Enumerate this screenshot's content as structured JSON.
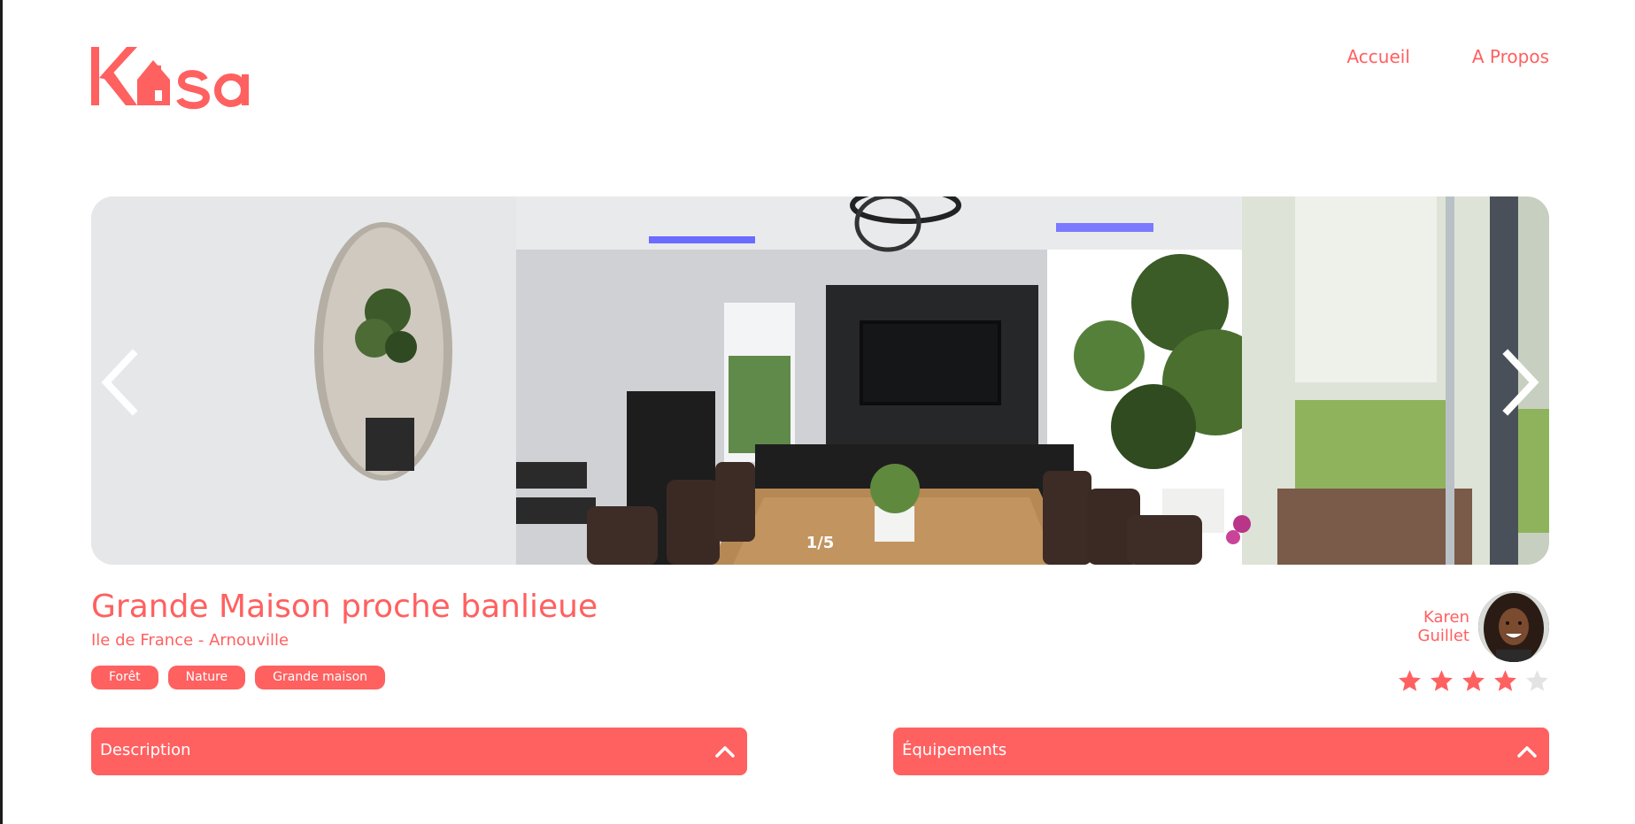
{
  "header": {
    "logo_text": "Kasa",
    "nav": [
      {
        "label": "Accueil"
      },
      {
        "label": "A Propos"
      }
    ]
  },
  "gallery": {
    "counter": "1/5",
    "prev_icon": "chevron-left-icon",
    "next_icon": "chevron-right-icon"
  },
  "listing": {
    "title": "Grande Maison proche banlieue",
    "location": "Ile de France - Arnouville",
    "tags": [
      "Forêt",
      "Nature",
      "Grande maison"
    ]
  },
  "host": {
    "first_name": "Karen",
    "last_name": "Guillet",
    "rating": 4,
    "rating_max": 5
  },
  "collapses": {
    "description_label": "Description",
    "equipment_label": "Équipements",
    "chevron_icon": "chevron-up-icon"
  },
  "colors": {
    "brand": "#ff6060",
    "star_empty": "#e3e3e3",
    "white": "#ffffff"
  }
}
